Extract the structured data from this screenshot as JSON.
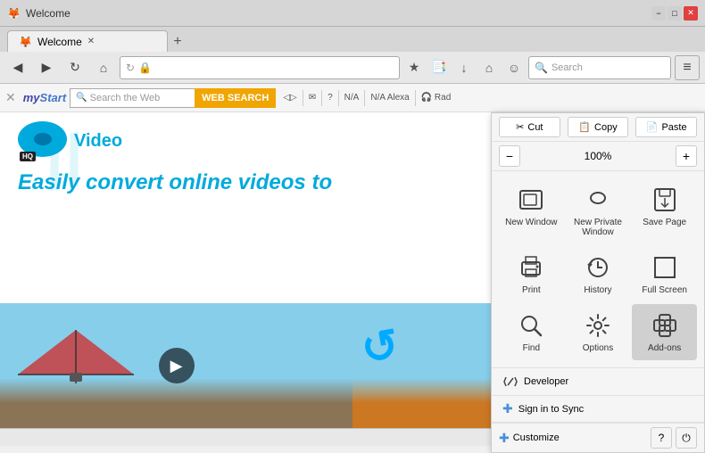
{
  "window": {
    "title": "Welcome",
    "controls": {
      "minimize": "−",
      "maximize": "□",
      "close": "✕"
    }
  },
  "tabs": [
    {
      "label": "Welcome",
      "active": true
    }
  ],
  "tab_new": "+",
  "navbar": {
    "back": "◀",
    "forward": "▶",
    "refresh": "↻",
    "home": "⌂",
    "address": "",
    "refresh_icon": "↻",
    "search_placeholder": "Search",
    "star": "★",
    "bookmark": "📑",
    "download": "↓",
    "menu": "≡"
  },
  "toolbar": {
    "mystart": "my",
    "mystart_end": "Start",
    "search_placeholder": "Search the Web",
    "web_search_btn": "WEB SEARCH",
    "icons": [
      "◁▷",
      "✉",
      "?",
      "N/A",
      "N/A",
      "Alexa",
      "🎧",
      "Rad"
    ],
    "close_icon": "✕"
  },
  "page": {
    "watermark": "//",
    "hq_badge": "HQ",
    "video_label": "Video",
    "tagline": "Easily convert online videos to",
    "play_icon": "▶"
  },
  "menu": {
    "cut_label": "Cut",
    "copy_label": "Copy",
    "paste_label": "Paste",
    "zoom_value": "100%",
    "zoom_minus": "−",
    "zoom_plus": "+",
    "items": [
      {
        "id": "new-window",
        "icon": "⬜",
        "label": "New Window"
      },
      {
        "id": "new-private",
        "icon": "🎭",
        "label": "New Private\nWindow"
      },
      {
        "id": "save-page",
        "icon": "💾",
        "label": "Save Page"
      },
      {
        "id": "print",
        "icon": "🖨",
        "label": "Print"
      },
      {
        "id": "history",
        "icon": "🕐",
        "label": "History"
      },
      {
        "id": "full-screen",
        "icon": "⛶",
        "label": "Full Screen"
      },
      {
        "id": "find",
        "icon": "🔍",
        "label": "Find"
      },
      {
        "id": "options",
        "icon": "⚙",
        "label": "Options"
      },
      {
        "id": "add-ons",
        "icon": "🧩",
        "label": "Add-ons"
      },
      {
        "id": "developer",
        "icon": "🔧",
        "label": "Developer"
      }
    ],
    "sign_in": "Sign in to Sync",
    "sign_in_icon": "✚",
    "customize": "Customize",
    "customize_icon": "✚",
    "help_icon": "?",
    "power_icon": "⏻",
    "colors": {
      "addons_bg": "#cccccc",
      "addons_text": "#333"
    }
  },
  "statusbar": {
    "text": ""
  }
}
